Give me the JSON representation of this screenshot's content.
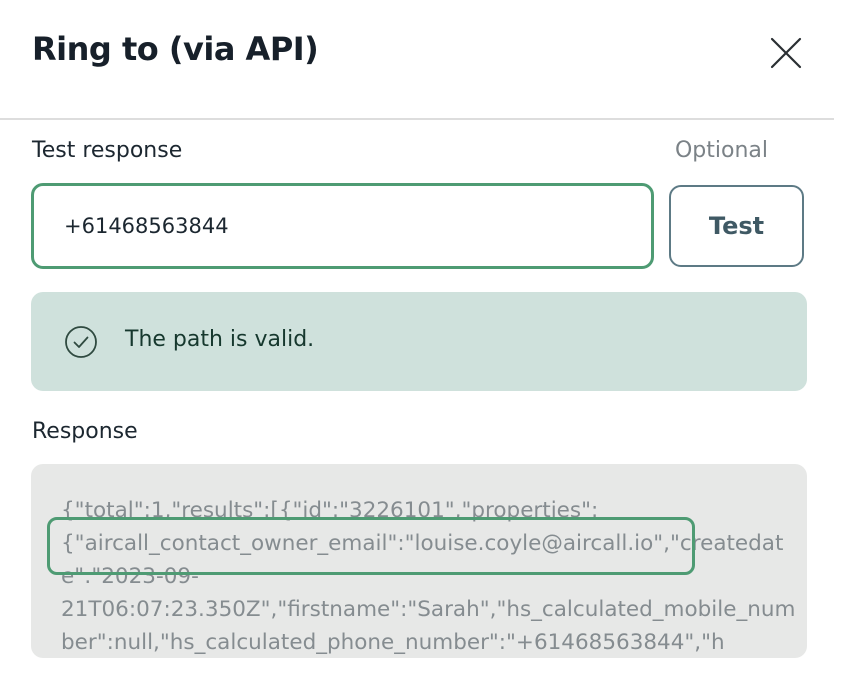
{
  "dialog": {
    "title": "Ring to (via API)",
    "close_icon": "close-icon"
  },
  "test_field": {
    "label": "Test response",
    "optional": "Optional",
    "value": "+61468563844",
    "button_label": "Test"
  },
  "alert": {
    "icon": "check-circle-icon",
    "message": "The path is valid."
  },
  "response": {
    "label": "Response",
    "text": "{\"total\":1,\"results\":[{\"id\":\"3226101\",\"properties\":\n{\"aircall_contact_owner_email\":\"louise.coyle@aircall.io\",\"createdate\":\"2023-09-\n21T06:07:23.350Z\",\"firstname\":\"Sarah\",\"hs_calculated_mobile_number\":null,\"hs_calculated_phone_number\":\"+61468563844\",\"h"
  },
  "colors": {
    "accent_green": "#4e9b73",
    "alert_bg": "#cfe1dc",
    "response_bg": "#e7e8e7"
  }
}
